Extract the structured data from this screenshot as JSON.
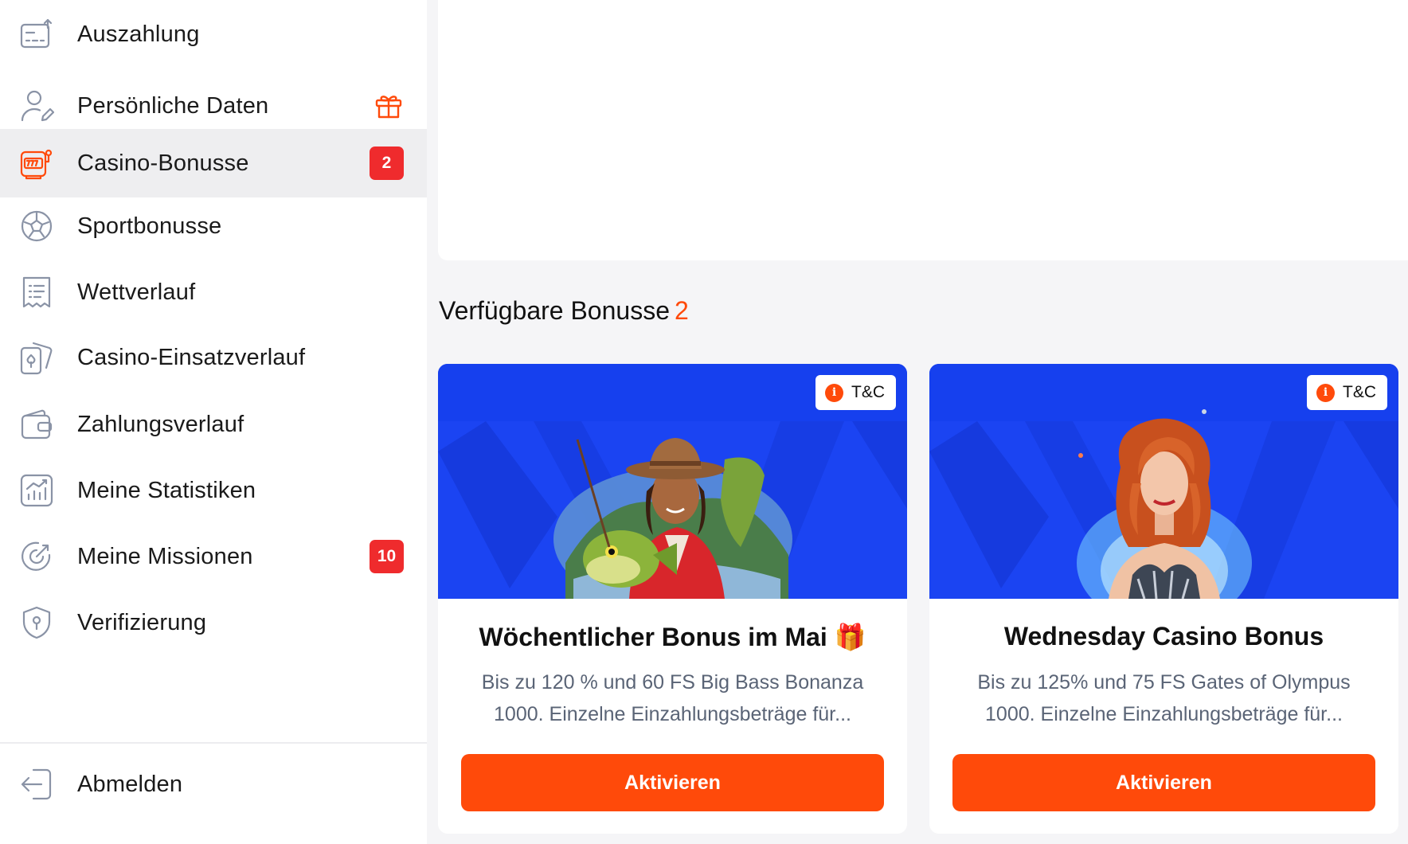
{
  "sidebar": {
    "items": [
      {
        "label": "Auszahlung",
        "icon": "withdraw-icon"
      },
      {
        "label": "Persönliche Daten",
        "icon": "user-edit-icon",
        "extra": "gift-icon"
      },
      {
        "label": "Casino-Bonusse",
        "icon": "slot-machine-icon",
        "badge": "2",
        "active": true
      },
      {
        "label": "Sportbonusse",
        "icon": "soccer-ball-icon"
      },
      {
        "label": "Wettverlauf",
        "icon": "receipt-icon"
      },
      {
        "label": "Casino-Einsatzverlauf",
        "icon": "cards-icon"
      },
      {
        "label": "Zahlungsverlauf",
        "icon": "wallet-icon"
      },
      {
        "label": "Meine Statistiken",
        "icon": "stats-chart-icon"
      },
      {
        "label": "Meine Missionen",
        "icon": "target-icon",
        "badge": "10"
      },
      {
        "label": "Verifizierung",
        "icon": "shield-icon"
      },
      {
        "label": "Abmelden",
        "icon": "logout-icon"
      }
    ]
  },
  "main": {
    "section_title": "Verfügbare Bonusse",
    "section_count": "2",
    "cards": [
      {
        "tc_label": "T&C",
        "tc_icon": "i",
        "title": "Wöchentlicher Bonus im Mai 🎁",
        "desc": "Bis zu 120 % und 60 FS Big Bass Bonanza 1000. Einzelne Einzahlungsbeträge für...",
        "button": "Aktivieren",
        "image": "cowgirl-with-fish-illustration"
      },
      {
        "tc_label": "T&C",
        "tc_icon": "i",
        "title": "Wednesday Casino Bonus",
        "desc": "Bis zu 125% und 75 FS Gates of Olympus 1000. Einzelne Einzahlungsbeträge für...",
        "button": "Aktivieren",
        "image": "redhead-woman-illustration"
      }
    ]
  },
  "colors": {
    "accent": "#ff4a0a",
    "badge": "#ef2b2d",
    "card_image_bg": "#1b44f2",
    "active_row": "#eeeef0"
  }
}
